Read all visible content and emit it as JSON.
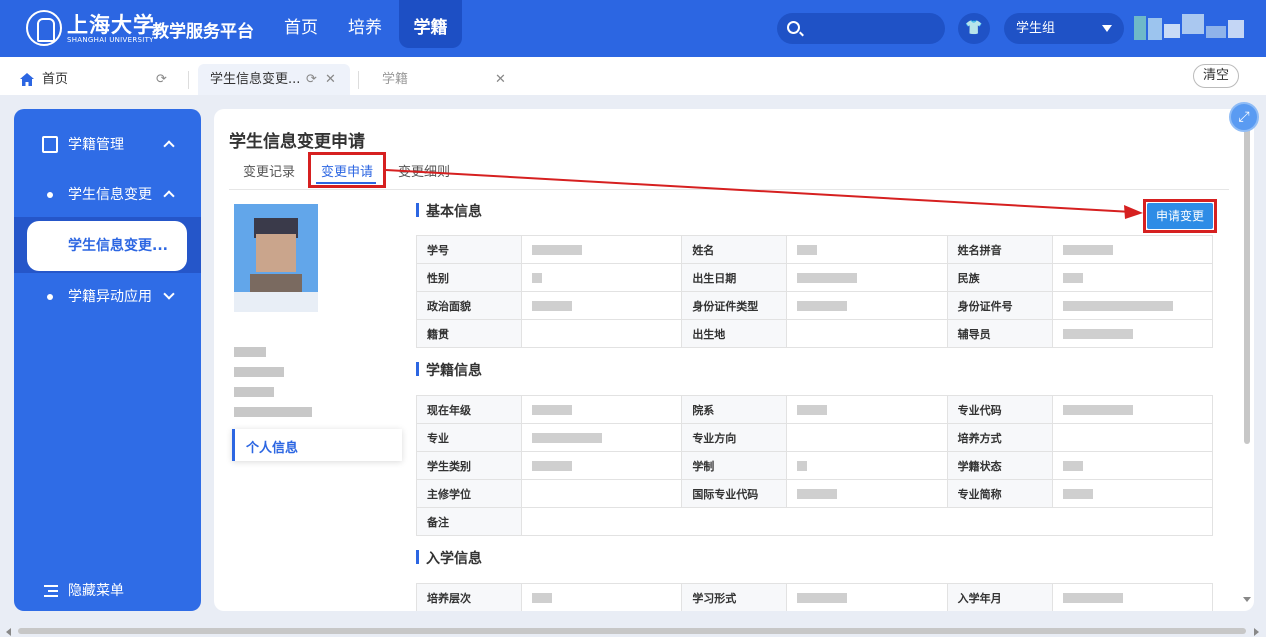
{
  "header": {
    "university_name": "上海大学",
    "university_sub": "SHANGHAI UNIVERSITY",
    "platform_title": "教学服务平台",
    "nav": [
      {
        "label": "首页"
      },
      {
        "label": "培养"
      },
      {
        "label": "学籍"
      }
    ],
    "search_placeholder": "",
    "role_select_value": "学生组",
    "brand_color": "#2c66e2"
  },
  "tabs": {
    "home_label": "首页",
    "current_label": "学生信息变更...",
    "other_label": "学籍",
    "clear_label": "清空"
  },
  "sidebar": {
    "group_label": "学籍管理",
    "sub1_label": "学生信息变更",
    "active_label": "学生信息变更...",
    "sub2_label": "学籍异动应用",
    "hide_label": "隐藏菜单"
  },
  "main": {
    "title": "学生信息变更申请",
    "content_tabs": [
      {
        "label": "变更记录"
      },
      {
        "label": "变更申请"
      },
      {
        "label": "变更细则"
      }
    ],
    "personal_card_label": "个人信息",
    "apply_button_label": "申请变更",
    "sections": {
      "basic": {
        "title": "基本信息",
        "labels": [
          "学号",
          "姓名",
          "姓名拼音",
          "性别",
          "出生日期",
          "民族",
          "政治面貌",
          "身份证件类型",
          "身份证件号",
          "籍贯",
          "出生地",
          "辅导员"
        ]
      },
      "status": {
        "title": "学籍信息",
        "labels": [
          "现在年级",
          "院系",
          "专业代码",
          "专业",
          "专业方向",
          "培养方式",
          "学生类别",
          "学制",
          "学籍状态",
          "主修学位",
          "国际专业代码",
          "专业简称",
          "备注"
        ]
      },
      "enroll": {
        "title": "入学信息",
        "labels": [
          "培养层次",
          "学习形式",
          "入学年月"
        ]
      }
    }
  },
  "annotation_color": "#d62020"
}
